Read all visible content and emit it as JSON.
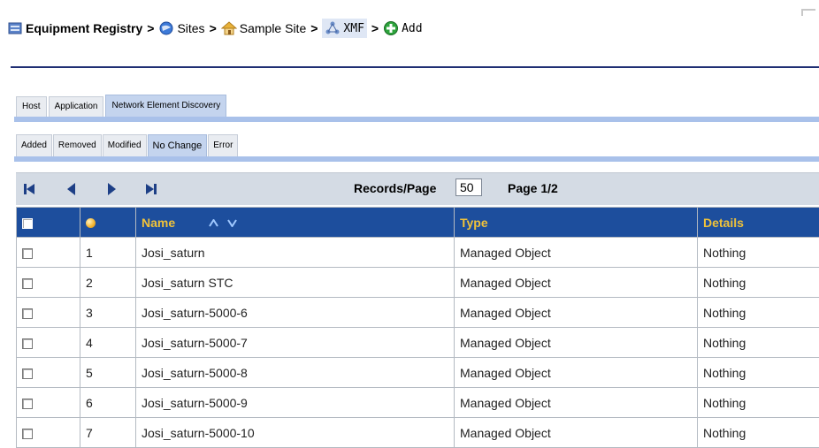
{
  "breadcrumb": {
    "items": [
      {
        "label": "Equipment Registry",
        "icon": "registry-icon"
      },
      {
        "label": "Sites",
        "icon": "globe-icon"
      },
      {
        "label": "Sample Site",
        "icon": "house-icon"
      },
      {
        "label": "XMF",
        "icon": "network-node-icon"
      },
      {
        "label": "Add",
        "icon": "add-plus-icon"
      }
    ],
    "separator": ">"
  },
  "tabs": [
    "Host",
    "Application",
    "Network Element Discovery"
  ],
  "active_tab": "Network Element Discovery",
  "subtabs": [
    "Added",
    "Removed",
    "Modified",
    "No Change",
    "Error"
  ],
  "active_subtab": "No Change",
  "pager": {
    "records_label": "Records/Page",
    "records_per_page": "50",
    "page_info": "Page 1/2",
    "icons": [
      "first-page-icon",
      "previous-page-icon",
      "next-page-icon",
      "last-page-icon"
    ]
  },
  "grid": {
    "columns": {
      "name": "Name",
      "type": "Type",
      "details": "Details"
    },
    "status_icon": "status-dot-icon",
    "sort_icons": [
      "sort-ascending-icon",
      "sort-descending-icon"
    ],
    "rows": [
      {
        "index": "1",
        "name": "Josi_saturn",
        "type": "Managed Object",
        "details": "Nothing"
      },
      {
        "index": "2",
        "name": "Josi_saturn STC",
        "type": "Managed Object",
        "details": "Nothing"
      },
      {
        "index": "3",
        "name": "Josi_saturn-5000-6",
        "type": "Managed Object",
        "details": "Nothing"
      },
      {
        "index": "4",
        "name": "Josi_saturn-5000-7",
        "type": "Managed Object",
        "details": "Nothing"
      },
      {
        "index": "5",
        "name": "Josi_saturn-5000-8",
        "type": "Managed Object",
        "details": "Nothing"
      },
      {
        "index": "6",
        "name": "Josi_saturn-5000-9",
        "type": "Managed Object",
        "details": "Nothing"
      },
      {
        "index": "7",
        "name": "Josi_saturn-5000-10",
        "type": "Managed Object",
        "details": "Nothing"
      }
    ]
  },
  "colors": {
    "header_bg": "#1d4e9d",
    "header_text": "#f0c23a",
    "tab_active": "#c4d4ee",
    "tab_bar": "#a9c1ea",
    "rule": "#1f2e73"
  }
}
